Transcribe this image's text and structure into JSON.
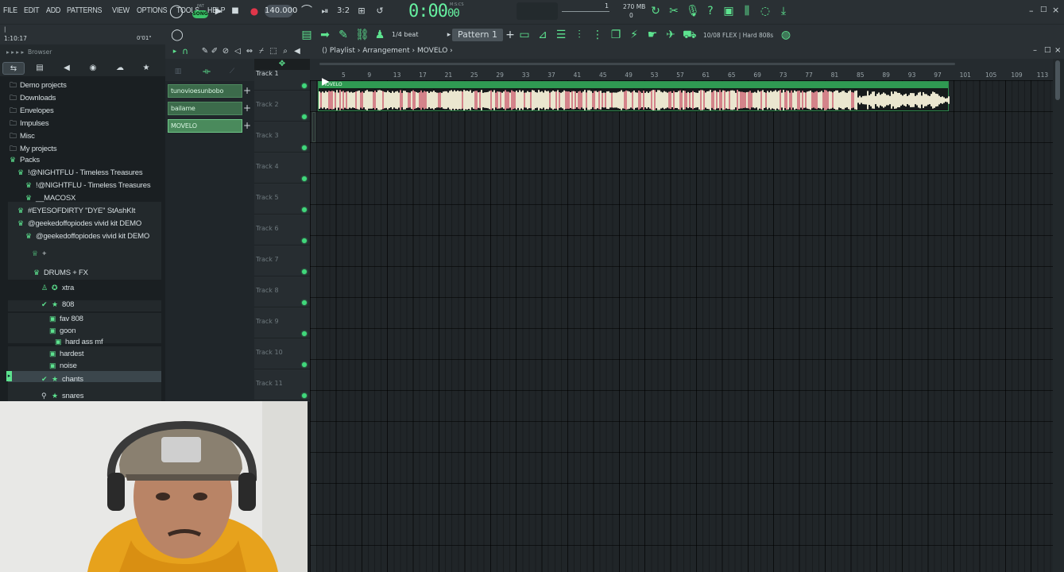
{
  "menu": [
    "FILE",
    "EDIT",
    "ADD",
    "PATTERNS",
    "VIEW",
    "OPTIONS",
    "TOOLS",
    "HELP"
  ],
  "transport": {
    "song_toggle": "SONG",
    "pat_label": "PAT",
    "tempo": "140.000",
    "time_main": "0:00",
    "time_sub": "00",
    "time_unit": "M:S:CS",
    "memory": "270 MB",
    "cpu": "0",
    "step_display": "1"
  },
  "hints": {
    "line1": "|",
    "line2": "1:10:17",
    "line3": "0'01\""
  },
  "toolbar2": {
    "snap": "1/4 beat",
    "pattern": "Pattern 1",
    "plugin_info": "10/08  FLEX | Hard 808s"
  },
  "browser": {
    "title": "Browser",
    "items": [
      {
        "label": "Demo projects",
        "type": "folder"
      },
      {
        "label": "Downloads",
        "type": "folder"
      },
      {
        "label": "Envelopes",
        "type": "folder"
      },
      {
        "label": "Impulses",
        "type": "folder"
      },
      {
        "label": "Misc",
        "type": "folder"
      },
      {
        "label": "My projects",
        "type": "folder"
      },
      {
        "label": "Packs",
        "type": "pack"
      },
      {
        "label": "!@NIGHTFLU - Timeless Treasures",
        "type": "pack"
      },
      {
        "label": "!@NIGHTFLU - Timeless Treasures",
        "type": "pack"
      },
      {
        "label": "__MACOSX",
        "type": "pack"
      },
      {
        "label": "#EYESOFDIRTY ''DYE'' StAshKIt",
        "type": "pack"
      },
      {
        "label": "@geekedoffopiodes vivid kit DEMO",
        "type": "pack"
      },
      {
        "label": "@geekedoffopiodes vivid kit DEMO",
        "type": "pack"
      },
      {
        "label": "+",
        "type": "emoji"
      },
      {
        "label": "DRUMS + FX",
        "type": "pack"
      },
      {
        "label": "xtra",
        "type": "emoji"
      },
      {
        "label": "808",
        "type": "emoji"
      },
      {
        "label": "fav 808",
        "type": "sub"
      },
      {
        "label": "goon",
        "type": "sub"
      },
      {
        "label": "hard ass mf",
        "type": "sub"
      },
      {
        "label": "hardest",
        "type": "sub"
      },
      {
        "label": "noise",
        "type": "sub"
      },
      {
        "label": "chants",
        "type": "emoji"
      },
      {
        "label": "snares",
        "type": "emoji"
      }
    ]
  },
  "playlist": {
    "breadcrumb": [
      "Playlist",
      "Arrangement",
      "MOVELO"
    ],
    "patterns": [
      "tunovioesunbobo",
      "bailame",
      "MOVELO"
    ],
    "tracks": [
      "Track 1",
      "Track 2",
      "Track 3",
      "Track 4",
      "Track 5",
      "Track 6",
      "Track 7",
      "Track 8",
      "Track 9",
      "Track 10",
      "Track 11"
    ],
    "bars": [
      "5",
      "9",
      "13",
      "17",
      "21",
      "25",
      "29",
      "33",
      "37",
      "41",
      "45",
      "49",
      "53",
      "57",
      "61",
      "65",
      "69",
      "73",
      "77",
      "81",
      "85",
      "89",
      "93",
      "97",
      "101",
      "105",
      "109",
      "113"
    ],
    "clip_name": "MOVELO",
    "accent": "#5de38f",
    "clip_color": "#2f9a52"
  }
}
